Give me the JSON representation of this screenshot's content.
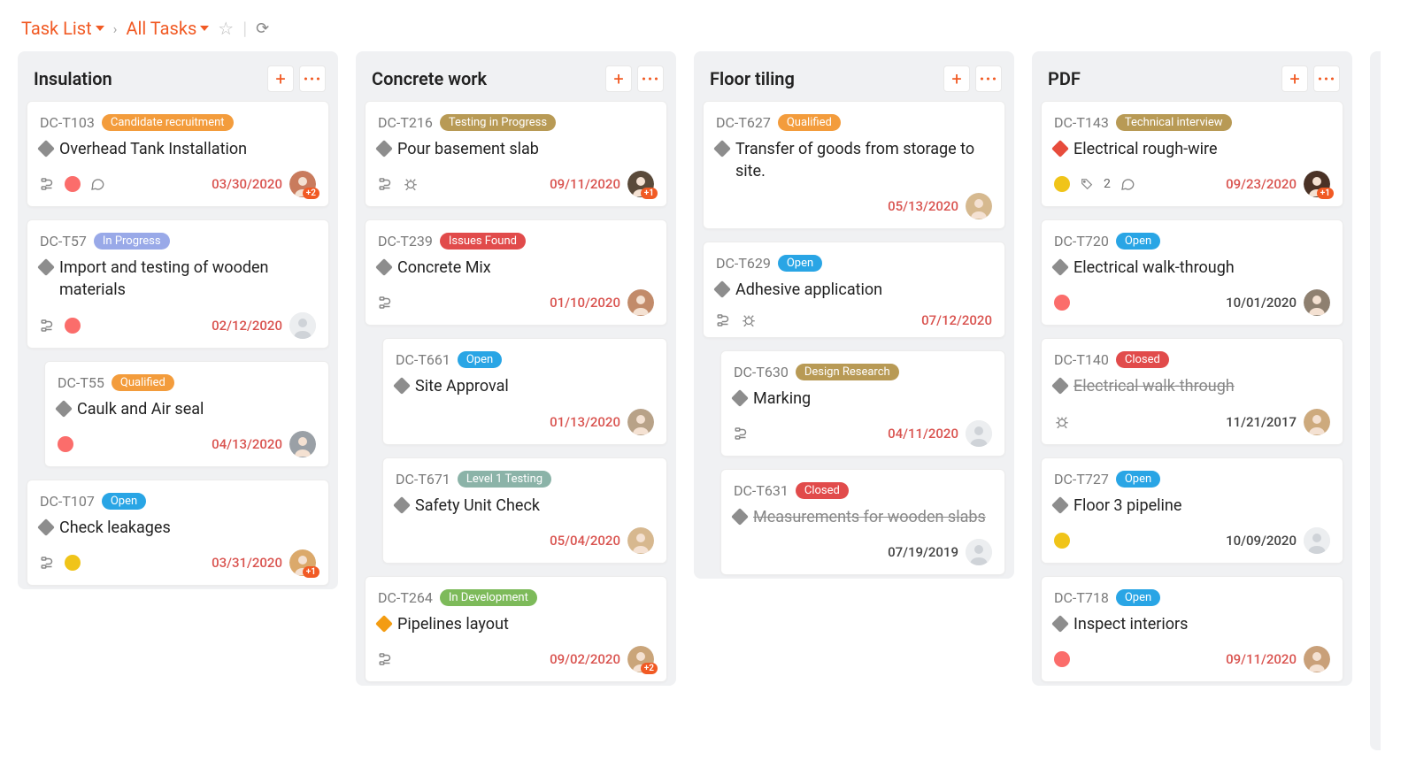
{
  "breadcrumb": {
    "task_list": "Task List",
    "all_tasks": "All Tasks"
  },
  "columns": [
    {
      "title": "Insulation",
      "cards": [
        {
          "id": "DC-T103",
          "status": "Candidate recruitment",
          "status_color": "#f39c3c",
          "prio": "grey",
          "title": "Overhead Tank Installation",
          "closed": false,
          "icons": [
            "subtask",
            "dot-red",
            "comment"
          ],
          "date": "03/30/2020",
          "date_black": false,
          "avatar": "a",
          "extra": "+2",
          "indented": false
        },
        {
          "id": "DC-T57",
          "status": "In Progress",
          "status_color": "#99a9e8",
          "prio": "grey",
          "title": "Import and testing of wooden materials",
          "closed": false,
          "icons": [
            "subtask",
            "dot-red"
          ],
          "date": "02/12/2020",
          "date_black": false,
          "avatar": "blank",
          "extra": "",
          "indented": false
        },
        {
          "id": "DC-T55",
          "status": "Qualified",
          "status_color": "#f39c3c",
          "prio": "grey",
          "title": "Caulk and Air seal",
          "closed": false,
          "icons": [
            "dot-red"
          ],
          "date": "04/13/2020",
          "date_black": false,
          "avatar": "b",
          "extra": "",
          "indented": true
        },
        {
          "id": "DC-T107",
          "status": "Open",
          "status_color": "#29a5e5",
          "prio": "grey",
          "title": "Check leakages",
          "closed": false,
          "icons": [
            "subtask",
            "dot-yellow"
          ],
          "date": "03/31/2020",
          "date_black": false,
          "avatar": "c",
          "extra": "+1",
          "indented": false
        }
      ]
    },
    {
      "title": "Concrete work",
      "cards": [
        {
          "id": "DC-T216",
          "status": "Testing in Progress",
          "status_color": "#b89a55",
          "prio": "grey",
          "title": "Pour basement slab",
          "closed": false,
          "icons": [
            "subtask",
            "bug"
          ],
          "date": "09/11/2020",
          "date_black": false,
          "avatar": "d",
          "extra": "+1",
          "indented": false
        },
        {
          "id": "DC-T239",
          "status": "Issues Found",
          "status_color": "#e14b4b",
          "prio": "grey",
          "title": "Concrete Mix",
          "closed": false,
          "icons": [
            "subtask"
          ],
          "date": "01/10/2020",
          "date_black": false,
          "avatar": "e",
          "extra": "",
          "indented": false
        },
        {
          "id": "DC-T661",
          "status": "Open",
          "status_color": "#29a5e5",
          "prio": "grey",
          "title": "Site Approval",
          "closed": false,
          "icons": [],
          "date": "01/13/2020",
          "date_black": false,
          "avatar": "f",
          "extra": "",
          "indented": true
        },
        {
          "id": "DC-T671",
          "status": "Level 1 Testing",
          "status_color": "#8bb3a8",
          "prio": "grey",
          "title": "Safety Unit Check",
          "closed": false,
          "icons": [],
          "date": "05/04/2020",
          "date_black": false,
          "avatar": "g",
          "extra": "",
          "indented": true
        },
        {
          "id": "DC-T264",
          "status": "In Development",
          "status_color": "#7dba5a",
          "prio": "orange",
          "title": "Pipelines layout",
          "closed": false,
          "icons": [
            "subtask"
          ],
          "date": "09/02/2020",
          "date_black": false,
          "avatar": "h",
          "extra": "+2",
          "indented": false
        }
      ]
    },
    {
      "title": "Floor tiling",
      "cards": [
        {
          "id": "DC-T627",
          "status": "Qualified",
          "status_color": "#f39c3c",
          "prio": "grey",
          "title": "Transfer of goods from storage to site.",
          "closed": false,
          "icons": [],
          "date": "05/13/2020",
          "date_black": false,
          "avatar": "i",
          "extra": "",
          "indented": false
        },
        {
          "id": "DC-T629",
          "status": "Open",
          "status_color": "#29a5e5",
          "prio": "grey",
          "title": "Adhesive application",
          "closed": false,
          "icons": [
            "subtask",
            "bug"
          ],
          "date": "07/12/2020",
          "date_black": false,
          "avatar": "",
          "extra": "",
          "indented": false
        },
        {
          "id": "DC-T630",
          "status": "Design Research",
          "status_color": "#b89a55",
          "prio": "grey",
          "title": "Marking",
          "closed": false,
          "icons": [
            "subtask"
          ],
          "date": "04/11/2020",
          "date_black": false,
          "avatar": "blank",
          "extra": "",
          "indented": true
        },
        {
          "id": "DC-T631",
          "status": "Closed",
          "status_color": "#e14b4b",
          "prio": "grey",
          "title": "Measurements for wooden slabs",
          "closed": true,
          "icons": [],
          "date": "07/19/2019",
          "date_black": true,
          "avatar": "blank",
          "extra": "",
          "indented": true
        }
      ]
    },
    {
      "title": "PDF",
      "cards": [
        {
          "id": "DC-T143",
          "status": "Technical interview",
          "status_color": "#b89a55",
          "prio": "red",
          "title": "Electrical rough-wire",
          "closed": false,
          "icons": [
            "dot-yellow",
            "tag-2",
            "comment"
          ],
          "date": "09/23/2020",
          "date_black": false,
          "avatar": "j",
          "extra": "+1",
          "indented": false
        },
        {
          "id": "DC-T720",
          "status": "Open",
          "status_color": "#29a5e5",
          "prio": "grey",
          "title": "Electrical walk-through",
          "closed": false,
          "icons": [
            "dot-red"
          ],
          "date": "10/01/2020",
          "date_black": true,
          "avatar": "k",
          "extra": "",
          "indented": false
        },
        {
          "id": "DC-T140",
          "status": "Closed",
          "status_color": "#e14b4b",
          "prio": "grey",
          "title": "Electrical walk-through",
          "closed": true,
          "icons": [
            "bug"
          ],
          "date": "11/21/2017",
          "date_black": true,
          "avatar": "l",
          "extra": "",
          "indented": false
        },
        {
          "id": "DC-T727",
          "status": "Open",
          "status_color": "#29a5e5",
          "prio": "grey",
          "title": "Floor 3 pipeline",
          "closed": false,
          "icons": [
            "dot-yellow"
          ],
          "date": "10/09/2020",
          "date_black": true,
          "avatar": "blank",
          "extra": "",
          "indented": false
        },
        {
          "id": "DC-T718",
          "status": "Open",
          "status_color": "#29a5e5",
          "prio": "grey",
          "title": "Inspect interiors",
          "closed": false,
          "icons": [
            "dot-red"
          ],
          "date": "09/11/2020",
          "date_black": false,
          "avatar": "m",
          "extra": "",
          "indented": false
        }
      ]
    }
  ],
  "icons": {
    "tag_count": "2"
  }
}
